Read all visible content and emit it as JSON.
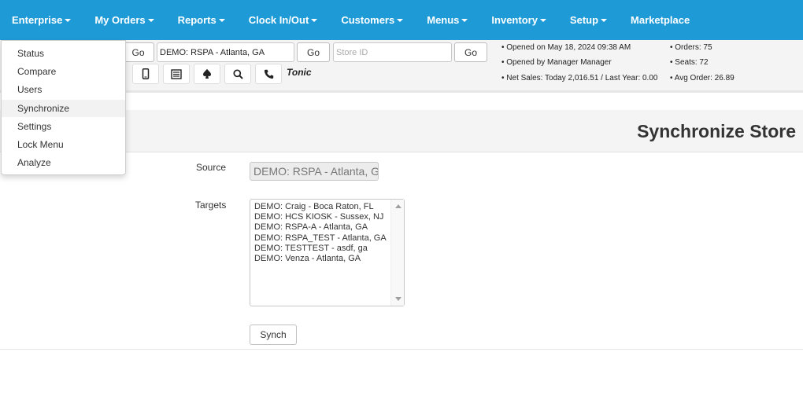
{
  "nav": {
    "items": [
      {
        "label": "Enterprise",
        "caret": true
      },
      {
        "label": "My Orders",
        "caret": true
      },
      {
        "label": "Reports",
        "caret": true
      },
      {
        "label": "Clock In/Out",
        "caret": true
      },
      {
        "label": "Customers",
        "caret": true
      },
      {
        "label": "Menus",
        "caret": true
      },
      {
        "label": "Inventory",
        "caret": true
      },
      {
        "label": "Setup",
        "caret": true
      },
      {
        "label": "Marketplace",
        "caret": false
      }
    ]
  },
  "toolbar": {
    "go_label_1": "Go",
    "store_select_value": "DEMO: RSPA - Atlanta, GA",
    "go_label_2": "Go",
    "store_id_placeholder": "Store ID",
    "go_label_3": "Go",
    "brand": "Tonic",
    "icons": [
      "mobile-icon",
      "list-icon",
      "spade-icon",
      "search-icon",
      "phone-icon"
    ]
  },
  "store_info": {
    "opened_on": "• Opened on May 18, 2024 09:38 AM",
    "opened_by": "• Opened by Manager Manager",
    "net_sales": "• Net Sales: Today 2,016.51 / Last Year: 0.00",
    "orders": "• Orders: 75",
    "seats": "• Seats: 72",
    "avg_order": "• Avg Order: 26.89"
  },
  "page": {
    "title": "Synchronize Store"
  },
  "form": {
    "source_label": "Source",
    "source_value": "DEMO: RSPA - Atlanta, GA",
    "targets_label": "Targets",
    "targets": [
      "DEMO: Craig - Boca Raton, FL",
      "DEMO: HCS KIOSK - Sussex, NJ",
      "DEMO: RSPA-A - Atlanta, GA",
      "DEMO: RSPA_TEST - Atlanta, GA",
      "DEMO: TESTTEST - asdf, ga",
      "DEMO: Venza - Atlanta, GA"
    ],
    "synch_label": "Synch"
  },
  "dropdown": {
    "items": [
      "Status",
      "Compare",
      "Users",
      "Synchronize",
      "Settings",
      "Lock Menu",
      "Analyze"
    ],
    "active": "Synchronize"
  },
  "colors": {
    "navbar": "#1e9bd7",
    "toolbar_bg": "#f4f4f4"
  }
}
